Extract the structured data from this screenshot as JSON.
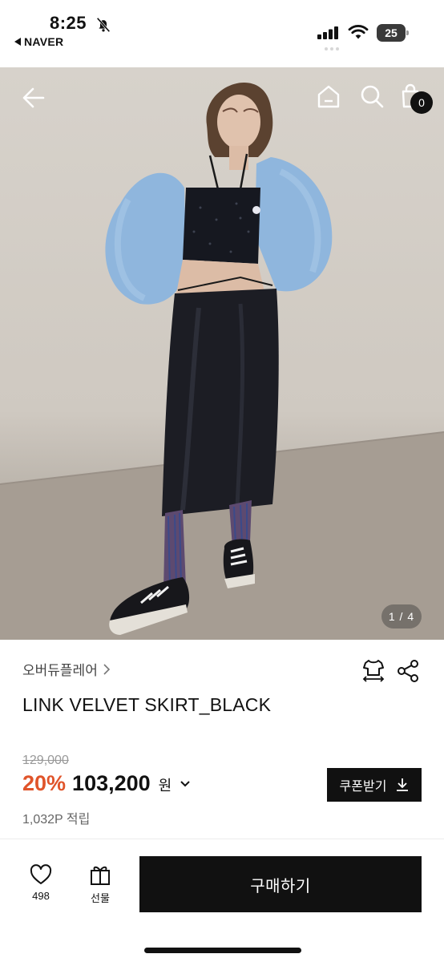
{
  "status_bar": {
    "time": "8:25",
    "back_app": "NAVER",
    "battery": "25"
  },
  "hero": {
    "cart_count": "0",
    "pager": "1 / 4",
    "icons": [
      "back-arrow-icon",
      "home-icon",
      "search-icon",
      "cart-icon"
    ]
  },
  "product": {
    "brand": "오버듀플레어",
    "title": "LINK VELVET SKIRT_BLACK",
    "original_price": "129,000",
    "discount": "20%",
    "price": "103,200",
    "currency": "원",
    "coupon_label": "쿠폰받기",
    "points": "1,032P 적립"
  },
  "bottom_bar": {
    "like_count": "498",
    "gift_label": "선물",
    "buy_label": "구매하기"
  },
  "colors": {
    "discount": "#e0542a",
    "primary": "#111111",
    "muted": "#999999"
  }
}
